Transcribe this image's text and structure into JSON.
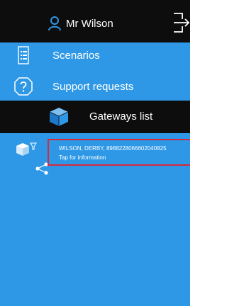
{
  "header": {
    "user_name": "Mr Wilson",
    "logout_icon": "logout-icon",
    "user_icon": "user-icon"
  },
  "menu": [
    {
      "label": "Scenarios",
      "icon": "scenarios-icon"
    },
    {
      "label": "Support requests",
      "icon": "help-icon"
    }
  ],
  "gateways": {
    "label": "Gateways list",
    "icon": "gateway-box-icon"
  },
  "gateway_list": [
    {
      "title": "WILSON, DERBY, 8988228066602040825",
      "subtitle": "Tap for information",
      "icons": [
        "gateway-box-icon",
        "filter-icon",
        "share-icon"
      ]
    }
  ],
  "colors": {
    "background": "#2e98e6",
    "header": "#0d0d0d",
    "highlight": "#d6293a",
    "text": "#ffffff"
  }
}
